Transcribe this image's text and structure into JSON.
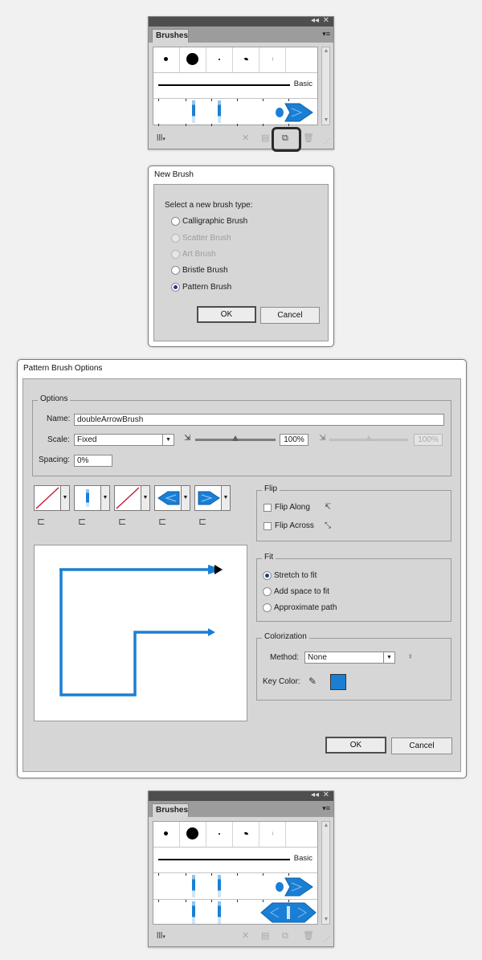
{
  "brushes_panel_before": {
    "tab_label": "Brushes",
    "collapse_glyph": "◂◂",
    "close_glyph": "✕",
    "menu_glyph": "▾≡",
    "basic_label": "Basic",
    "icons": [
      "brush-libraries-icon",
      "remove-stroke-icon",
      "brush-options-icon",
      "new-brush-icon",
      "delete-brush-icon"
    ],
    "highlighted_button": "new-brush-icon"
  },
  "new_brush_dialog": {
    "title": "New Brush",
    "prompt": "Select a new brush type:",
    "options": [
      {
        "label": "Calligraphic Brush",
        "enabled": true,
        "selected": false
      },
      {
        "label": "Scatter Brush",
        "enabled": false,
        "selected": false
      },
      {
        "label": "Art Brush",
        "enabled": false,
        "selected": false
      },
      {
        "label": "Bristle Brush",
        "enabled": true,
        "selected": false
      },
      {
        "label": "Pattern Brush",
        "enabled": true,
        "selected": true
      }
    ],
    "ok_label": "OK",
    "cancel_label": "Cancel"
  },
  "pattern_brush_dialog": {
    "title": "Pattern Brush Options",
    "options_group_title": "Options",
    "name_label": "Name:",
    "name_value": "doubleArrowBrush",
    "scale_label": "Scale:",
    "scale_value": "Fixed",
    "scale_percent": "100%",
    "scale_percent_max": "100%",
    "spacing_label": "Spacing:",
    "spacing_value": "0%",
    "flip_group_title": "Flip",
    "flip_along_label": "Flip Along",
    "flip_across_label": "Flip Across",
    "fit_group_title": "Fit",
    "fit_options": [
      {
        "label": "Stretch to fit",
        "selected": true
      },
      {
        "label": "Add space to fit",
        "selected": false
      },
      {
        "label": "Approximate path",
        "selected": false
      }
    ],
    "colorization_group_title": "Colorization",
    "method_label": "Method:",
    "method_value": "None",
    "key_color_label": "Key Color:",
    "key_color": "#1a7fd4",
    "ok_label": "OK",
    "cancel_label": "Cancel"
  },
  "brushes_panel_after": {
    "tab_label": "Brushes",
    "collapse_glyph": "◂◂",
    "close_glyph": "✕",
    "menu_glyph": "▾≡",
    "basic_label": "Basic"
  },
  "colors": {
    "accent_blue": "#1a7fd4",
    "panel_gray": "#d6d6d6",
    "header_dark": "#4e4e4e"
  }
}
